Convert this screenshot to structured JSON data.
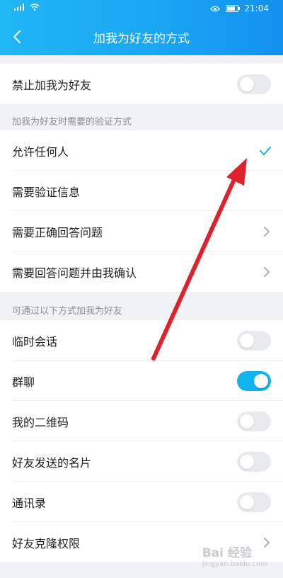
{
  "status_bar": {
    "time": "21:04"
  },
  "header": {
    "title": "加我为好友的方式"
  },
  "block_row": {
    "label": "禁止加我为好友",
    "toggle_on": false
  },
  "section_verify": {
    "label": "加我为好友时需要的验证方式",
    "items": [
      {
        "label": "允许任何人",
        "selected": true
      },
      {
        "label": "需要验证信息"
      },
      {
        "label": "需要正确回答问题"
      },
      {
        "label": "需要回答问题并由我确认"
      }
    ]
  },
  "section_ways": {
    "label": "可通过以下方式加我为好友",
    "items": [
      {
        "label": "临时会话",
        "toggle_on": false
      },
      {
        "label": "群聊",
        "toggle_on": true
      },
      {
        "label": "我的二维码",
        "toggle_on": false
      },
      {
        "label": "好友发送的名片",
        "toggle_on": false
      },
      {
        "label": "通讯录",
        "toggle_on": false
      },
      {
        "label": "好友克隆权限"
      }
    ]
  },
  "watermark": {
    "brand": "Bai 经验",
    "sub": "jingyan.baidu.com"
  },
  "colors": {
    "accent": "#10b3ee",
    "annotation_arrow": "#e0202a"
  }
}
